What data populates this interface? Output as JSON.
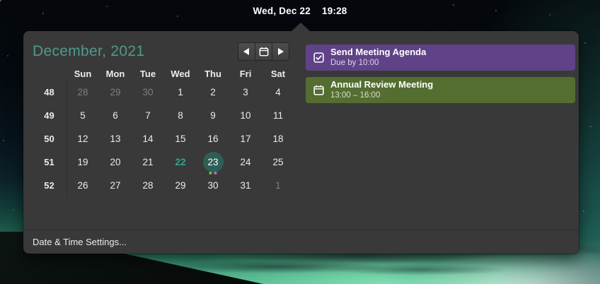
{
  "topbar": {
    "date": "Wed, Dec 22",
    "time": "19:28"
  },
  "calendar": {
    "title": "December, 2021",
    "nav_icons": {
      "prev": "chevron-left-icon",
      "today": "calendar-icon",
      "next": "chevron-right-icon"
    },
    "day_headers": [
      "Sun",
      "Mon",
      "Tue",
      "Wed",
      "Thu",
      "Fri",
      "Sat"
    ],
    "weeks": [
      {
        "num": "48",
        "days": [
          {
            "d": "28",
            "state": "other"
          },
          {
            "d": "29",
            "state": "other"
          },
          {
            "d": "30",
            "state": "other"
          },
          {
            "d": "1",
            "state": "normal"
          },
          {
            "d": "2",
            "state": "normal"
          },
          {
            "d": "3",
            "state": "normal"
          },
          {
            "d": "4",
            "state": "normal"
          }
        ]
      },
      {
        "num": "49",
        "days": [
          {
            "d": "5",
            "state": "normal"
          },
          {
            "d": "6",
            "state": "normal"
          },
          {
            "d": "7",
            "state": "normal"
          },
          {
            "d": "8",
            "state": "normal"
          },
          {
            "d": "9",
            "state": "normal"
          },
          {
            "d": "10",
            "state": "normal"
          },
          {
            "d": "11",
            "state": "normal"
          }
        ]
      },
      {
        "num": "50",
        "days": [
          {
            "d": "12",
            "state": "normal"
          },
          {
            "d": "13",
            "state": "normal"
          },
          {
            "d": "14",
            "state": "normal"
          },
          {
            "d": "15",
            "state": "normal"
          },
          {
            "d": "16",
            "state": "normal"
          },
          {
            "d": "17",
            "state": "normal"
          },
          {
            "d": "18",
            "state": "normal"
          }
        ]
      },
      {
        "num": "51",
        "days": [
          {
            "d": "19",
            "state": "normal"
          },
          {
            "d": "20",
            "state": "normal"
          },
          {
            "d": "21",
            "state": "normal"
          },
          {
            "d": "22",
            "state": "today"
          },
          {
            "d": "23",
            "state": "selected",
            "dots": [
              "#7fb92e",
              "#b06fd8"
            ]
          },
          {
            "d": "24",
            "state": "normal"
          },
          {
            "d": "25",
            "state": "normal"
          }
        ]
      },
      {
        "num": "52",
        "days": [
          {
            "d": "26",
            "state": "normal"
          },
          {
            "d": "27",
            "state": "normal"
          },
          {
            "d": "28",
            "state": "normal"
          },
          {
            "d": "29",
            "state": "normal"
          },
          {
            "d": "30",
            "state": "normal"
          },
          {
            "d": "31",
            "state": "normal"
          },
          {
            "d": "1",
            "state": "other"
          }
        ]
      }
    ]
  },
  "events": [
    {
      "icon": "checkbox-checked-icon",
      "title": "Send Meeting Agenda",
      "subtitle": "Due by 10:00",
      "bg": "#5f4287"
    },
    {
      "icon": "calendar-icon",
      "title": "Annual Review Meeting",
      "subtitle": "13:00 – 16:00",
      "bg": "#546d30"
    }
  ],
  "footer": {
    "settings_label": "Date & Time Settings..."
  },
  "colors": {
    "panel_bg": "#393939",
    "accent_teal": "#4f9a8a",
    "today_text": "#2fa98c",
    "selected_day_bg": "#2e5f57",
    "dot_task": "#7fb92e",
    "dot_event": "#b06fd8",
    "event_task_bg": "#5f4287",
    "event_meeting_bg": "#546d30"
  }
}
